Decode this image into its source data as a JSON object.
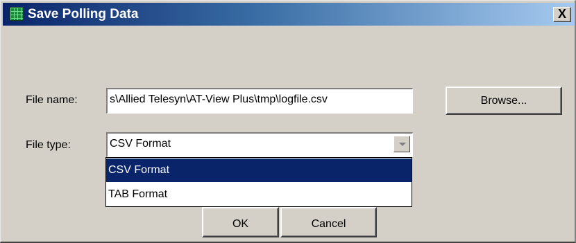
{
  "window": {
    "title": "Save Polling Data",
    "close_label": "X"
  },
  "form": {
    "file_name_label": "File name:",
    "file_name_value": "s\\Allied Telesyn\\AT-View Plus\\tmp\\logfile.csv",
    "file_type_label": "File type:",
    "file_type_selected": "CSV Format",
    "file_type_options": [
      "CSV Format",
      "TAB Format"
    ]
  },
  "buttons": {
    "browse": "Browse...",
    "ok": "OK",
    "cancel": "Cancel"
  },
  "icons": {
    "title": "grid-app-icon",
    "dropdown": "dropdown-arrow-icon"
  }
}
